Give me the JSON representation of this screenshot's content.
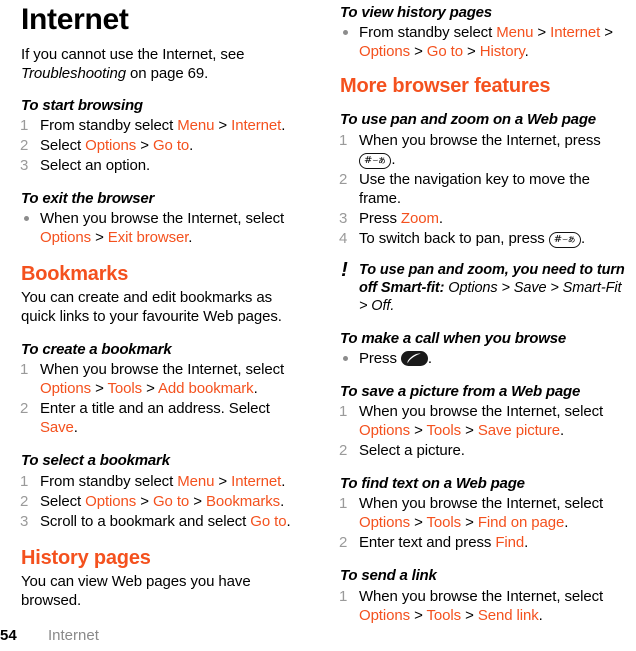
{
  "colors": {
    "accent": "#F4511E",
    "muted": "#9a9a9a",
    "text": "#000000"
  },
  "footer": {
    "page_number": "54",
    "section": "Internet"
  },
  "left_column": {
    "title": "Internet",
    "intro_part1": "If you cannot use the Internet, see ",
    "intro_italic": "Troubleshooting",
    "intro_part2": " on page 69.",
    "task_start_browsing": {
      "heading": "To start browsing",
      "steps": [
        {
          "num": "1",
          "pre": "From standby select ",
          "ui1": "Menu",
          "sep1": " > ",
          "ui2": "Internet",
          "post": "."
        },
        {
          "num": "2",
          "pre": "Select ",
          "ui1": "Options",
          "sep1": " > ",
          "ui2": "Go to",
          "post": "."
        },
        {
          "num": "3",
          "pre": "Select an option.",
          "ui1": "",
          "sep1": "",
          "ui2": "",
          "post": ""
        }
      ]
    },
    "task_exit_browser": {
      "heading": "To exit the browser",
      "bullet": {
        "pre": "When you browse the Internet, select ",
        "ui1": "Options",
        "sep1": " > ",
        "ui2": "Exit browser",
        "post": "."
      }
    },
    "section_bookmarks": {
      "heading": "Bookmarks",
      "body": "You can create and edit bookmarks as quick links to your favourite Web pages."
    },
    "task_create_bookmark": {
      "heading": "To create a bookmark",
      "steps": [
        {
          "num": "1",
          "pre": "When you browse the Internet, select ",
          "ui1": "Options",
          "sep1": " > ",
          "ui2": "Tools",
          "sep2": " > ",
          "ui3": "Add bookmark",
          "post": "."
        },
        {
          "num": "2",
          "pre": "Enter a title and an address. Select ",
          "ui1": "Save",
          "post": "."
        }
      ]
    },
    "task_select_bookmark": {
      "heading": "To select a bookmark",
      "steps": [
        {
          "num": "1",
          "pre": "From standby select ",
          "ui1": "Menu",
          "sep1": " > ",
          "ui2": "Internet",
          "post": "."
        },
        {
          "num": "2",
          "pre": "Select ",
          "ui1": "Options",
          "sep1": " > ",
          "ui2": "Go to",
          "sep2": " > ",
          "ui3": "Bookmarks",
          "post": "."
        },
        {
          "num": "3",
          "pre": "Scroll to a bookmark and select ",
          "ui1": "Go to",
          "post": "."
        }
      ]
    },
    "section_history": {
      "heading": "History pages",
      "body": "You can view Web pages you have browsed."
    }
  },
  "right_column": {
    "task_view_history": {
      "heading": "To view history pages",
      "bullet": {
        "pre": "From standby select ",
        "ui1": "Menu",
        "sep1": " > ",
        "ui2": "Internet",
        "sep2": " > ",
        "ui3": "Options",
        "sep3": " > ",
        "ui4": "Go to",
        "sep4": " > ",
        "ui5": "History",
        "post": "."
      }
    },
    "section_more_features": {
      "heading": "More browser features"
    },
    "task_pan_zoom": {
      "heading": "To use pan and zoom on a Web page",
      "steps": [
        {
          "num": "1",
          "pre": "When you browse the Internet, press ",
          "key": "hash-key-icon",
          "post": "."
        },
        {
          "num": "2",
          "pre": "Use the navigation key to move the frame.",
          "post": ""
        },
        {
          "num": "3",
          "pre": "Press ",
          "ui1": "Zoom",
          "post": "."
        },
        {
          "num": "4",
          "pre": "To switch back to pan, press ",
          "key": "hash-key-icon",
          "post": "."
        }
      ]
    },
    "note": {
      "icon": "exclamation-icon",
      "strong_text": "To use pan and zoom, you need to turn off Smart-fit:",
      "rest_pre": " ",
      "ui1": "Options",
      "sep1": " > ",
      "ui2": "Save",
      "sep2": " > ",
      "ui3": "Smart-Fit",
      "sep3": " > ",
      "ui4": "Off",
      "post": "."
    },
    "task_make_call": {
      "heading": "To make a call when you browse",
      "bullet": {
        "pre": "Press ",
        "key": "call-key-icon",
        "post": "."
      }
    },
    "task_save_picture": {
      "heading": "To save a picture from a Web page",
      "steps": [
        {
          "num": "1",
          "pre": "When you browse the Internet, select ",
          "ui1": "Options",
          "sep1": " > ",
          "ui2": "Tools",
          "sep2": " > ",
          "ui3": "Save picture",
          "post": "."
        },
        {
          "num": "2",
          "pre": "Select a picture.",
          "post": ""
        }
      ]
    },
    "task_find_text": {
      "heading": "To find text on a Web page",
      "steps": [
        {
          "num": "1",
          "pre": "When you browse the Internet, select ",
          "ui1": "Options",
          "sep1": " > ",
          "ui2": "Tools",
          "sep2": " > ",
          "ui3": "Find on page",
          "post": "."
        },
        {
          "num": "2",
          "pre": "Enter text and press ",
          "ui1": "Find",
          "post": "."
        }
      ]
    },
    "task_send_link": {
      "heading": "To send a link",
      "steps": [
        {
          "num": "1",
          "pre": "When you browse the Internet, select ",
          "ui1": "Options",
          "sep1": " > ",
          "ui2": "Tools",
          "sep2": " > ",
          "ui3": "Send link",
          "post": "."
        }
      ]
    }
  }
}
